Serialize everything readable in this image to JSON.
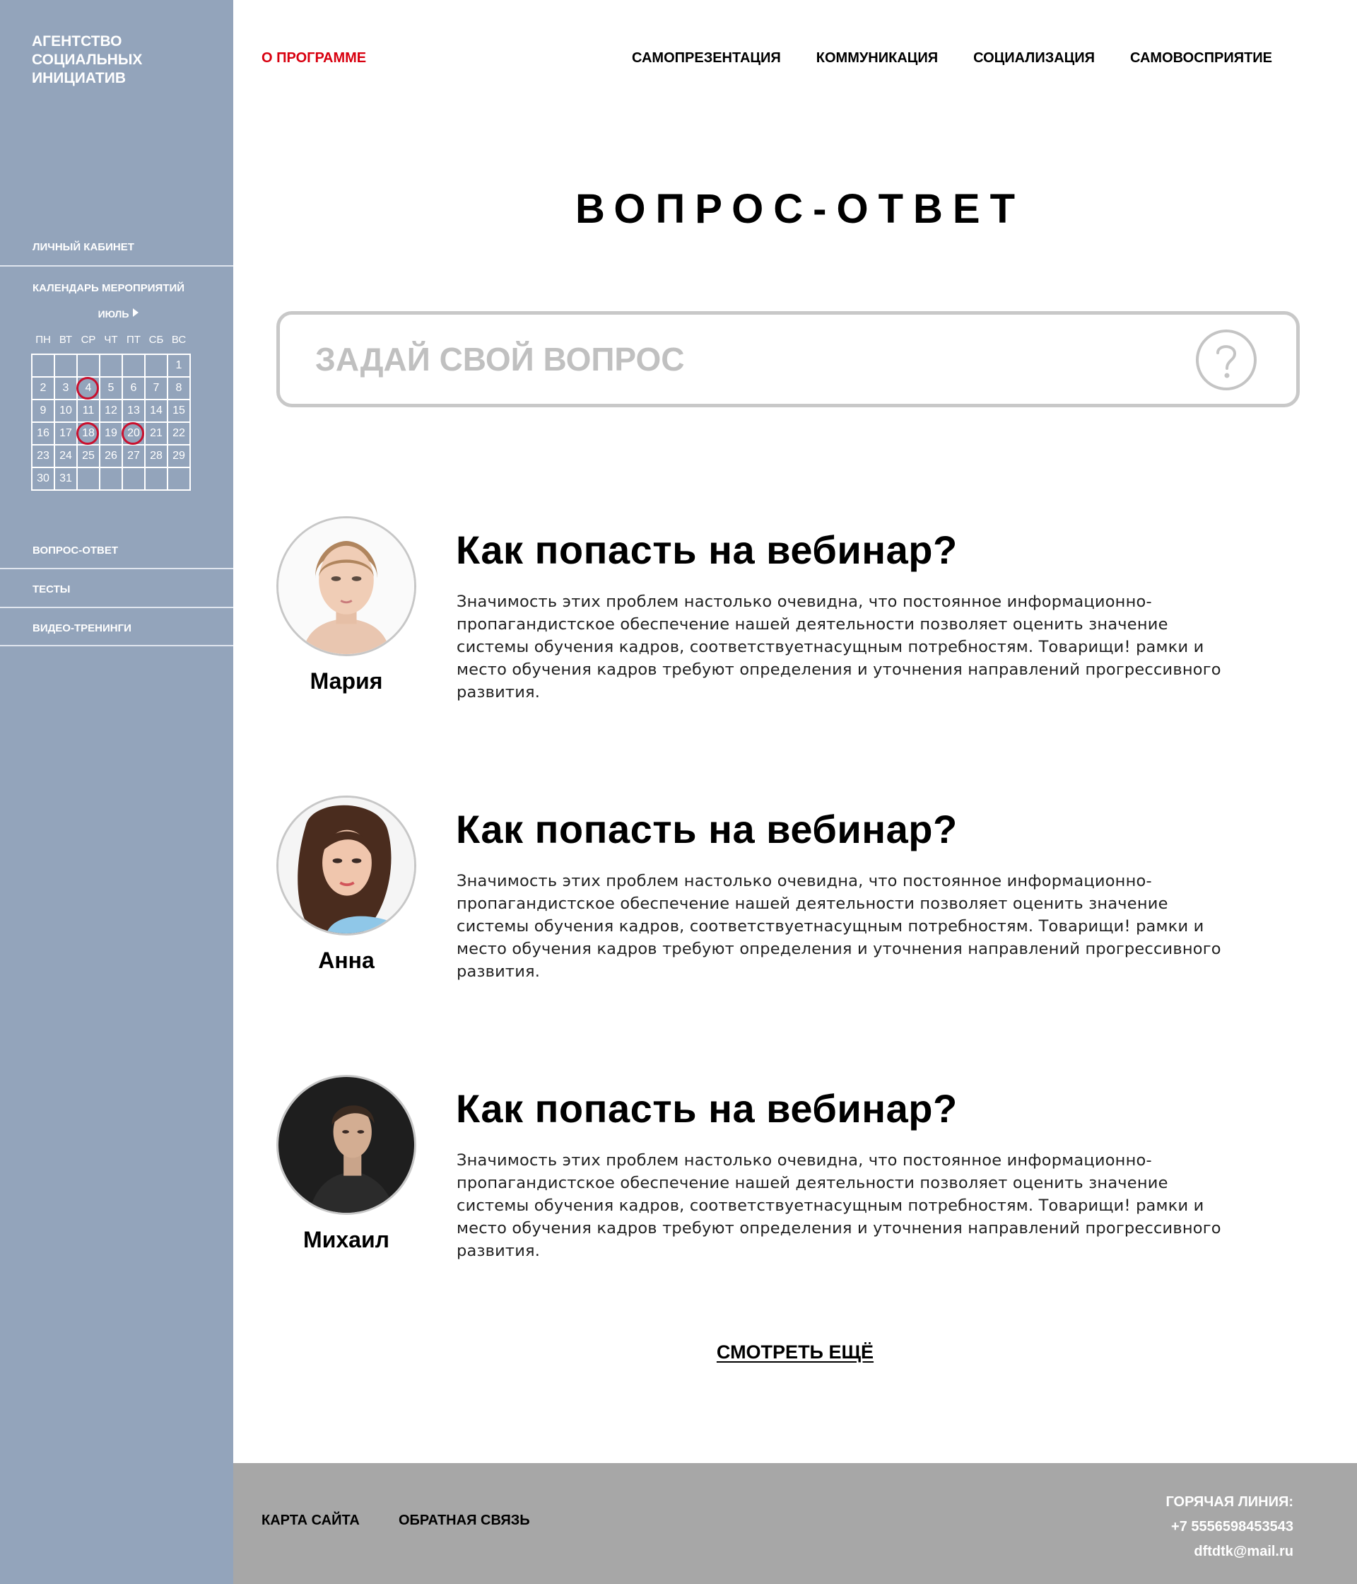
{
  "sidebar": {
    "logo": "АГЕНТСТВО\nСОЦИАЛЬНЫХ\nИНИЦИАТИВ",
    "cabinet": "ЛИЧНЫЙ КАБИНЕТ",
    "calendar_title": "КАЛЕНДАРЬ МЕРОПРИЯТИЙ",
    "month": "ИЮЛЬ",
    "weekdays": [
      "ПН",
      "ВТ",
      "СР",
      "ЧТ",
      "ПТ",
      "СБ",
      "ВС"
    ],
    "days": [
      "",
      "",
      "",
      "",
      "",
      "",
      "1",
      "2",
      "3",
      "4",
      "5",
      "6",
      "7",
      "8",
      "9",
      "10",
      "11",
      "12",
      "13",
      "14",
      "15",
      "16",
      "17",
      "18",
      "19",
      "20",
      "21",
      "22",
      "23",
      "24",
      "25",
      "26",
      "27",
      "28",
      "29",
      "30",
      "31",
      "",
      "",
      "",
      "",
      ""
    ],
    "event_days": [
      "4",
      "18",
      "20"
    ],
    "menu": [
      "ВОПРОС-ОТВЕТ",
      "ТЕСТЫ",
      "ВИДЕО-ТРЕНИНГИ"
    ]
  },
  "nav": {
    "program": "О ПРОГРАММЕ",
    "items": [
      "САМОПРЕЗЕНТАЦИЯ",
      "КОММУНИКАЦИЯ",
      "СОЦИАЛИЗАЦИЯ",
      "САМОВОСПРИЯТИЕ"
    ]
  },
  "page": {
    "title": "ВОПРОС-ОТВЕТ"
  },
  "search": {
    "placeholder": "ЗАДАЙ СВОЙ ВОПРОС",
    "icon": "question-circle-icon"
  },
  "questions": [
    {
      "author": "Мария",
      "title": "Как попасть на вебинар?",
      "text": "Значимость этих проблем настолько очевидна, что постоянное информационно-пропагандистское обеспечение нашей деятельности позволяет оценить значение системы обучения кадров, соответствуетнасущным потребностям. Товарищи! рамки и место обучения кадров требуют определения и уточнения направлений прогрессивного развития."
    },
    {
      "author": "Анна",
      "title": "Как попасть на вебинар?",
      "text": "Значимость этих проблем настолько очевидна, что постоянное информационно-пропагандистское обеспечение нашей деятельности позволяет оценить значение системы обучения кадров, соответствуетнасущным потребностям. Товарищи! рамки и место обучения кадров требуют определения и уточнения направлений прогрессивного развития."
    },
    {
      "author": "Михаил",
      "title": "Как попасть на вебинар?",
      "text": "Значимость этих проблем настолько очевидна, что постоянное информационно-пропагандистское обеспечение нашей деятельности позволяет оценить значение системы обучения кадров, соответствуетнасущным потребностям. Товарищи! рамки и место обучения кадров требуют определения и уточнения направлений прогрессивного развития."
    }
  ],
  "more": "СМОТРЕТЬ ЕЩЁ",
  "footer": {
    "sitemap": "КАРТА САЙТА",
    "feedback": "ОБРАТНАЯ СВЯЗЬ",
    "hotline_label": "ГОРЯЧАЯ ЛИНИЯ:",
    "phone": "+7 5556598453543",
    "email": "dftdtk@mail.ru"
  },
  "colors": {
    "sidebar": "#93a4bb",
    "accent": "#d8000f",
    "event_ring": "#c8102e",
    "footer": "#a7a7a7"
  }
}
